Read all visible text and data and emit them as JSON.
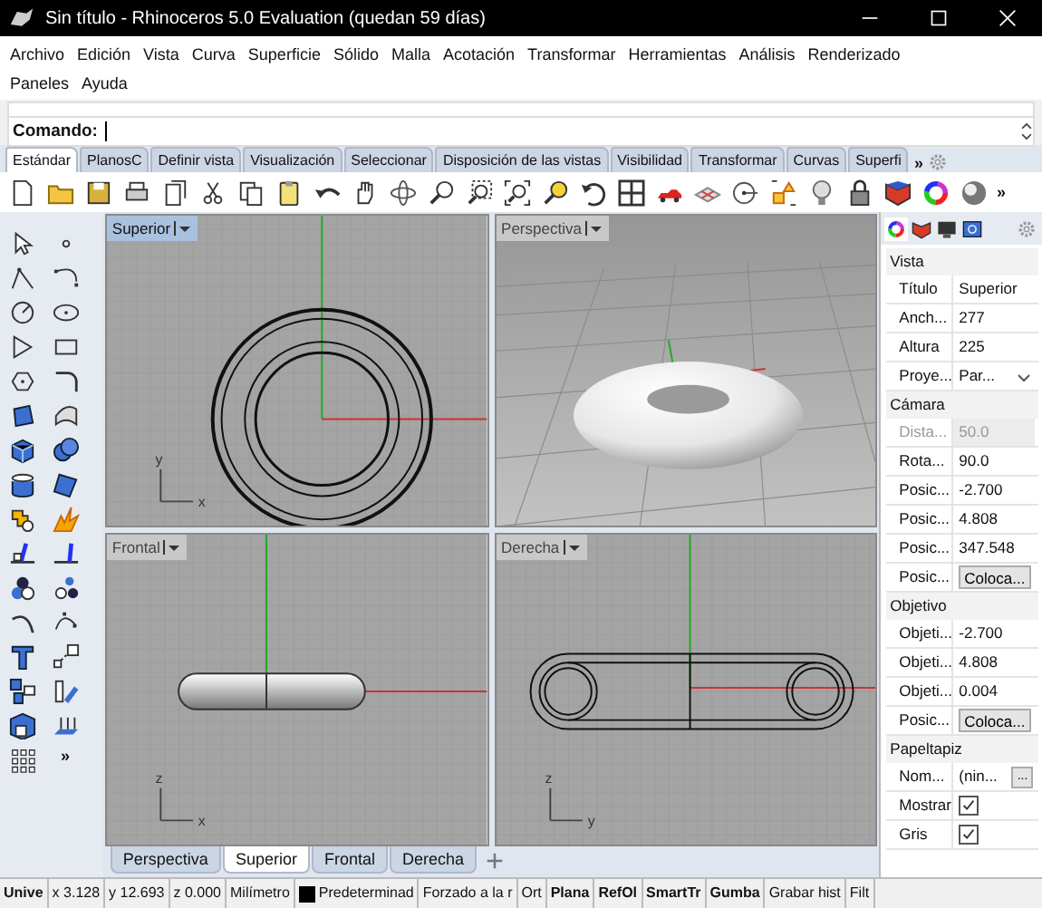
{
  "window": {
    "title": "Sin título - Rhinoceros 5.0 Evaluation (quedan 59 días)"
  },
  "menu": [
    "Archivo",
    "Edición",
    "Vista",
    "Curva",
    "Superficie",
    "Sólido",
    "Malla",
    "Acotación",
    "Transformar",
    "Herramientas",
    "Análisis",
    "Renderizado",
    "Paneles",
    "Ayuda"
  ],
  "command": {
    "label": "Comando:"
  },
  "toolbar_tabs": [
    {
      "label": "Estándar",
      "selected": true
    },
    {
      "label": "PlanosC",
      "selected": false
    },
    {
      "label": "Definir vista",
      "selected": false
    },
    {
      "label": "Visualización",
      "selected": false
    },
    {
      "label": "Seleccionar",
      "selected": false
    },
    {
      "label": "Disposición de las vistas",
      "selected": false
    },
    {
      "label": "Visibilidad",
      "selected": false
    },
    {
      "label": "Transformar",
      "selected": false
    },
    {
      "label": "Curvas",
      "selected": false
    },
    {
      "label": "Superfi",
      "selected": false
    }
  ],
  "toolbar_tabs_more": "»",
  "toolbar_more": "»",
  "side_toolbar_more": "»",
  "viewports": [
    {
      "title": "Superior",
      "kind": "top",
      "selected": true,
      "axes": [
        "x",
        "y"
      ]
    },
    {
      "title": "Perspectiva",
      "kind": "perspective",
      "selected": false
    },
    {
      "title": "Frontal",
      "kind": "front",
      "selected": false,
      "axes": [
        "x",
        "z"
      ]
    },
    {
      "title": "Derecha",
      "kind": "right",
      "selected": false,
      "axes": [
        "y",
        "z"
      ]
    }
  ],
  "viewport_tabs": [
    {
      "label": "Perspectiva",
      "selected": false
    },
    {
      "label": "Superior",
      "selected": true
    },
    {
      "label": "Frontal",
      "selected": false
    },
    {
      "label": "Derecha",
      "selected": false
    }
  ],
  "properties": {
    "sections": [
      {
        "title": "Vista",
        "rows": [
          {
            "label": "Título",
            "value": "Superior",
            "kind": "text",
            "disabled": false
          },
          {
            "label": "Anch...",
            "value": "277",
            "kind": "text",
            "disabled": false
          },
          {
            "label": "Altura",
            "value": "225",
            "kind": "text",
            "disabled": false
          },
          {
            "label": "Proye...",
            "value": "Par...",
            "kind": "dropdown",
            "disabled": false
          }
        ]
      },
      {
        "title": "Cámara",
        "rows": [
          {
            "label": "Dista...",
            "value": "50.0",
            "kind": "text",
            "disabled": true
          },
          {
            "label": "Rota...",
            "value": "90.0",
            "kind": "text",
            "disabled": false
          },
          {
            "label": "Posic...",
            "value": "-2.700",
            "kind": "text",
            "disabled": false
          },
          {
            "label": "Posic...",
            "value": "4.808",
            "kind": "text",
            "disabled": false
          },
          {
            "label": "Posic...",
            "value": "347.548",
            "kind": "text",
            "disabled": false
          },
          {
            "label": "Posic...",
            "value": "Coloca...",
            "kind": "button",
            "disabled": false
          }
        ]
      },
      {
        "title": "Objetivo",
        "rows": [
          {
            "label": "Objeti...",
            "value": "-2.700",
            "kind": "text",
            "disabled": false
          },
          {
            "label": "Objeti...",
            "value": "4.808",
            "kind": "text",
            "disabled": false
          },
          {
            "label": "Objeti...",
            "value": "0.004",
            "kind": "text",
            "disabled": false
          },
          {
            "label": "Posic...",
            "value": "Coloca...",
            "kind": "button",
            "disabled": false
          }
        ]
      },
      {
        "title": "Papeltapiz",
        "rows": [
          {
            "label": "Nom...",
            "value": "(nin...",
            "kind": "browse",
            "button": "...",
            "disabled": false
          },
          {
            "label": "Mostrar",
            "kind": "checkbox",
            "checked": true,
            "disabled": false
          },
          {
            "label": "Gris",
            "kind": "checkbox",
            "checked": true,
            "disabled": false
          }
        ]
      }
    ]
  },
  "status_bar": [
    {
      "text": "Unive",
      "bold": true
    },
    {
      "text": "x 3.128",
      "bold": false
    },
    {
      "text": "y 12.693",
      "bold": false
    },
    {
      "text": "z 0.000",
      "bold": false
    },
    {
      "text": "Milímetro",
      "bold": false
    },
    {
      "text": "Predeterminad",
      "bold": false,
      "color": "#000000"
    },
    {
      "text": "Forzado a la r",
      "bold": false
    },
    {
      "text": "Ort",
      "bold": false
    },
    {
      "text": "Plana",
      "bold": true
    },
    {
      "text": "RefOl",
      "bold": true
    },
    {
      "text": "SmartTr",
      "bold": true
    },
    {
      "text": "Gumba",
      "bold": true
    },
    {
      "text": "Grabar hist",
      "bold": false
    },
    {
      "text": "Filt",
      "bold": false
    }
  ]
}
